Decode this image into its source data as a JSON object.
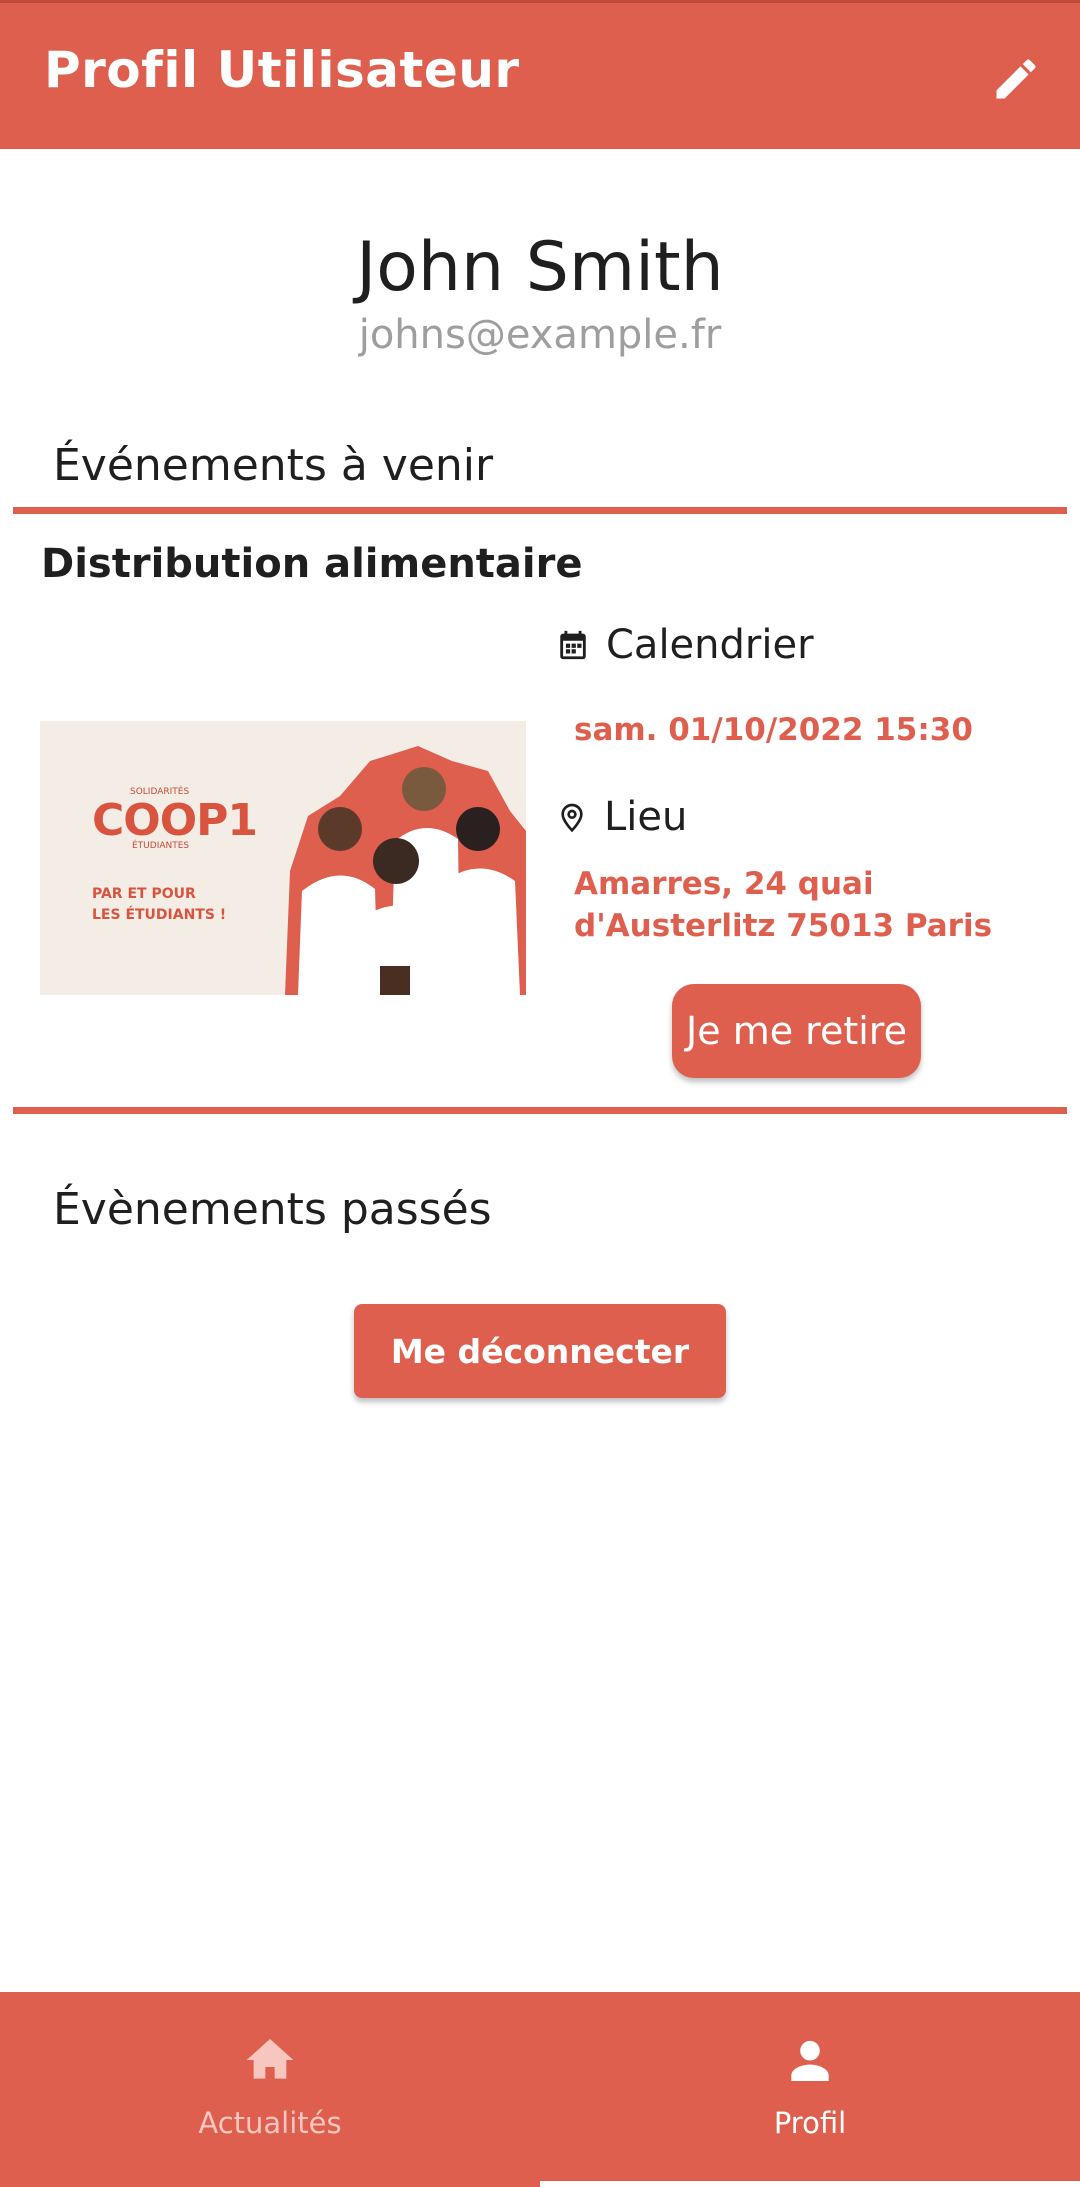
{
  "header": {
    "title": "Profil Utilisateur",
    "edit_icon": "pencil-icon"
  },
  "profile": {
    "name": "John Smith",
    "email": "johns@example.fr"
  },
  "upcoming": {
    "section_title": "Événements à venir",
    "event": {
      "title": "Distribution alimentaire",
      "image": {
        "logo_small": "SOLIDARITÉS",
        "logo_main": "COOP1",
        "logo_sub": "ÉTUDIANTES",
        "tagline_line1": "PAR ET POUR",
        "tagline_line2": "LES ÉTUDIANTS !"
      },
      "calendar_label": "Calendrier",
      "calendar_icon": "calendar-icon",
      "date": "sam. 01/10/2022 15:30",
      "place_label": "Lieu",
      "place_icon": "map-pin-icon",
      "address_line1": "Amarres, 24 quai",
      "address_line2": "d'Austerlitz 75013 Paris",
      "withdraw_label": "Je me retire"
    }
  },
  "past": {
    "section_title": "Évènements passés"
  },
  "logout_label": "Me déconnecter",
  "nav": {
    "items": [
      {
        "label": "Actualités",
        "icon": "home-icon",
        "active": false
      },
      {
        "label": "Profil",
        "icon": "person-icon",
        "active": true
      }
    ]
  },
  "colors": {
    "accent": "#df5f4e",
    "text": "#1f1f1f",
    "muted": "#9e9e9e",
    "nav_inactive_icon": "#f6c6bf"
  }
}
